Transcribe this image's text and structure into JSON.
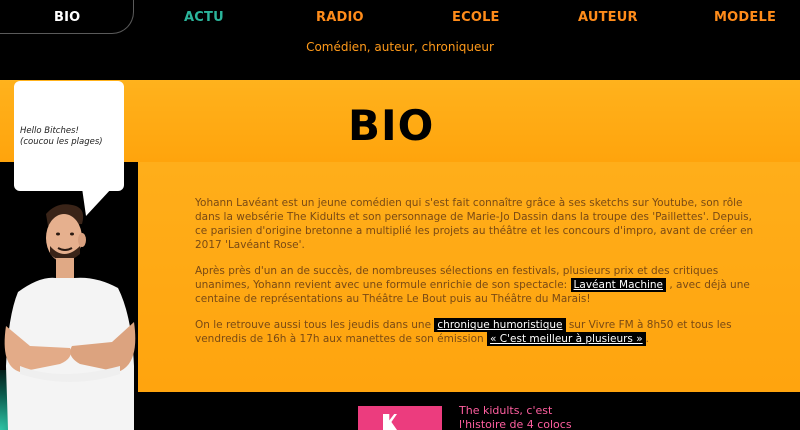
{
  "nav": {
    "bio": "BIO",
    "actu": "ACTU",
    "radio": "RADIO",
    "ecole": "ECOLE",
    "auteur": "AUTEUR",
    "modele": "MODELE"
  },
  "header": {
    "tagline": "Comédien, auteur, chroniqueur"
  },
  "hero": {
    "title": "BIO"
  },
  "bubble": {
    "line1": "Hello Bitches!",
    "line2": "(coucou les plages)"
  },
  "bio": {
    "p1": "Yohann Lavéant est un jeune comédien qui s'est fait connaître grâce à ses sketchs sur Youtube, son rôle dans la websérie The Kidults et son personnage de Marie-Jo Dassin dans la troupe des 'Paillettes'. Depuis, ce parisien d'origine bretonne a multiplié les projets au théâtre et les concours d'impro, avant de créer en 2017 'Lavéant Rose'.",
    "p2_before": "Après près d'un an de succès, de nombreuses sélections en festivals, plusieurs prix et des critiques unanimes, Yohann revient avec une formule enrichie de son spectacle: ",
    "p2_link": "Lavéant Machine",
    "p2_after": " , avec déjà une centaine de représentations au Théâtre Le Bout puis au Théâtre du Marais!",
    "p3_before": "On le retrouve aussi tous les jeudis dans une ",
    "p3_link1": "chronique humoristique",
    "p3_mid": " sur Vivre FM à 8h50 et tous les vendredis de 16h à 17h aux manettes de son émission ",
    "p3_link2": "« C'est meilleur à plusieurs »",
    "p3_after": "."
  },
  "kidults": {
    "text": "The kidults, c'est l'histoire de 4 colocs"
  },
  "colors": {
    "accent_orange": "#ffa40c",
    "nav_teal": "#2bb59b",
    "nav_orange": "#ff8c1a",
    "pink": "#ec3c7e"
  }
}
